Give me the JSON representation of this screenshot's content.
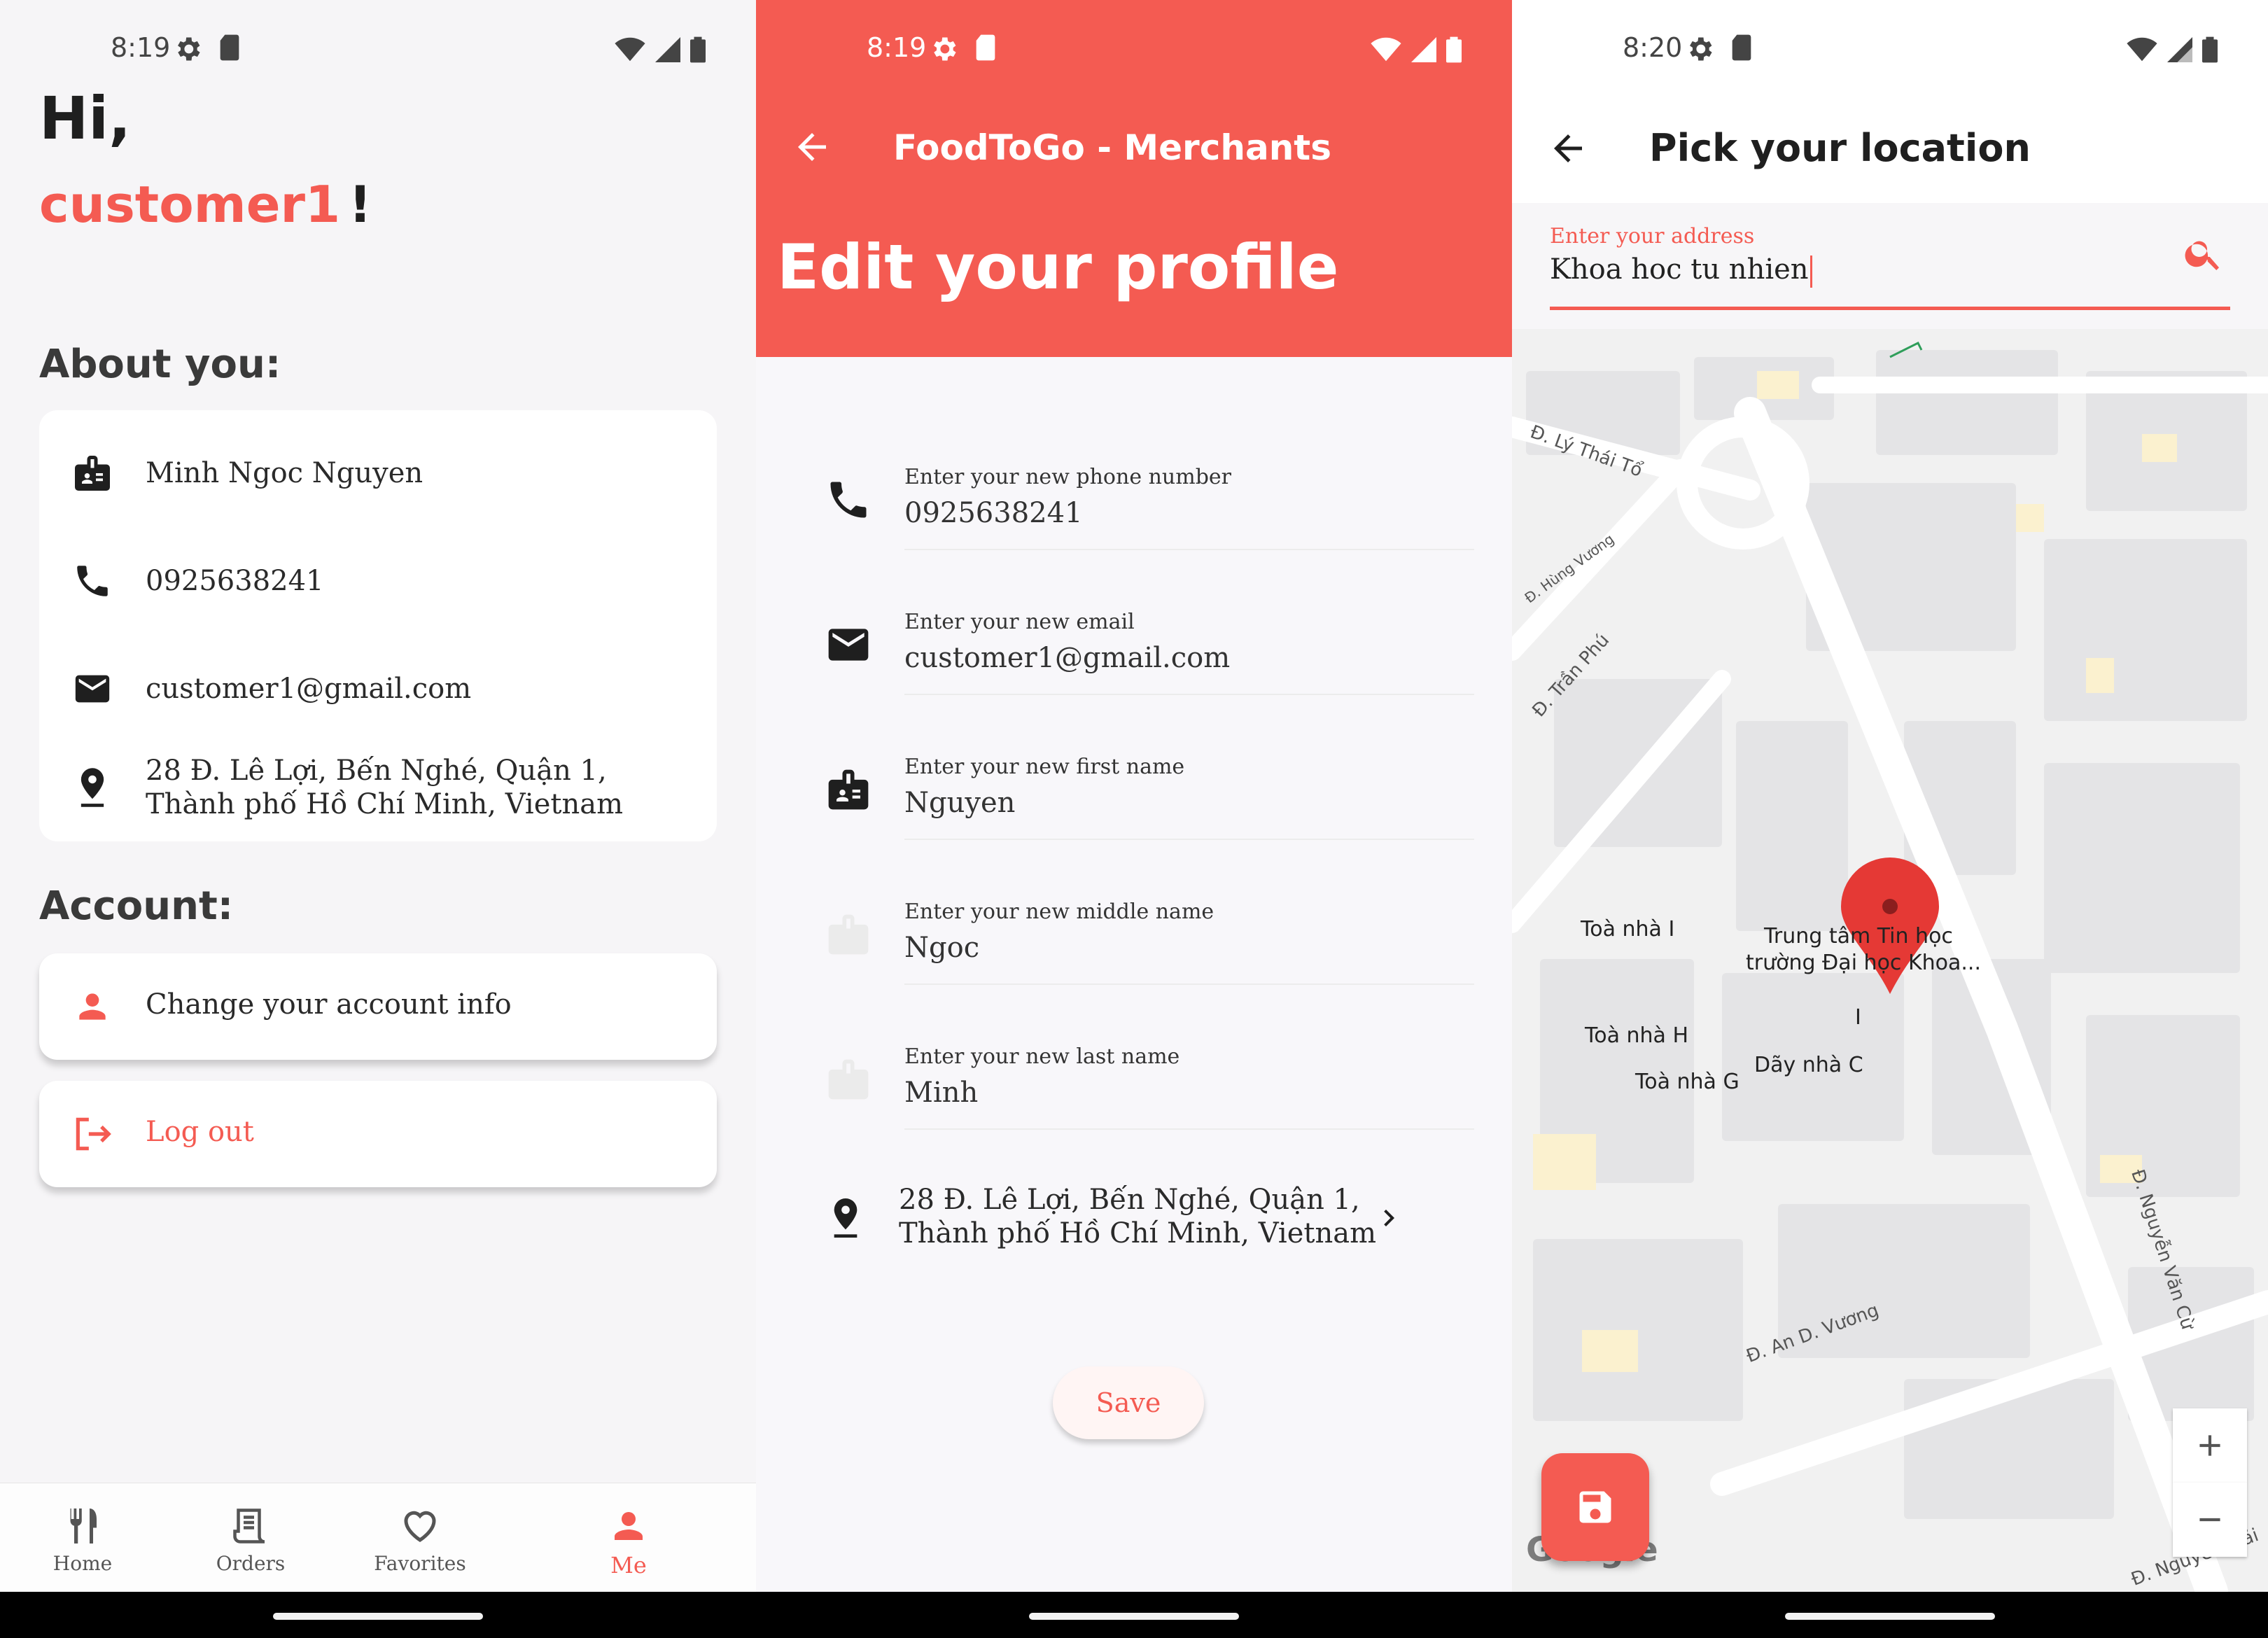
{
  "colors": {
    "accent": "#f45b52",
    "text_dark": "#1f1f1f"
  },
  "panel1": {
    "status_time": "8:19",
    "greeting": "Hi,",
    "username": "customer1",
    "exclamation": "!",
    "about_title": "About you:",
    "about": {
      "name": "Minh Ngoc Nguyen",
      "phone": "0925638241",
      "email": "customer1@gmail.com",
      "address": "28 Đ. Lê Lợi, Bến Nghé, Quận 1, Thành phố Hồ Chí Minh, Vietnam"
    },
    "account_title": "Account:",
    "change_info": "Change your account info",
    "logout": "Log out",
    "nav": {
      "home": "Home",
      "orders": "Orders",
      "favorites": "Favorites",
      "me": "Me"
    }
  },
  "panel2": {
    "status_time": "8:19",
    "app_title": "FoodToGo - Merchants",
    "heading": "Edit your profile",
    "fields": [
      {
        "label": "Enter your new phone number",
        "value": "0925638241"
      },
      {
        "label": "Enter your new email",
        "value": "customer1@gmail.com"
      },
      {
        "label": "Enter your new first name",
        "value": "Nguyen"
      },
      {
        "label": "Enter your new middle name",
        "value": "Ngoc"
      },
      {
        "label": "Enter your new last name",
        "value": "Minh"
      }
    ],
    "address_line1": "28 Đ. Lê Lợi, Bến Nghé, Quận 1,",
    "address_line2": "Thành phố Hồ Chí Minh, Vietnam",
    "save": "Save"
  },
  "panel3": {
    "status_time": "8:20",
    "title": "Pick your location",
    "address_label": "Enter your address",
    "address_value": "Khoa hoc tu nhien",
    "map": {
      "streets": [
        "Đ. Lý Thái Tổ",
        "Đ. Hùng Vương",
        "Đ. Trần Phú",
        "Đ. Nguyễn Văn Cừ",
        "Đ. An D. Vương",
        "Đ. Nguyễn Trãi"
      ],
      "places": [
        "Toà nhà I",
        "Trung tâm Tin học",
        "trường Đại học Khoa...",
        "I",
        "Toà nhà H",
        "Dãy nhà C",
        "Toà nhà G"
      ],
      "logo": "Google"
    }
  }
}
